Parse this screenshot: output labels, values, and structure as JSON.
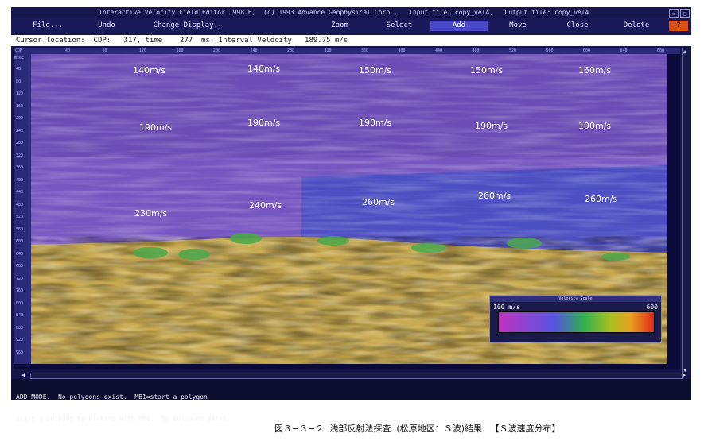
{
  "window": {
    "title": "Interactive Velocity Field Editor 1998.6,  (c) 1993 Advance Geophysical Corp.,   Input file: copy_vel4,   Output file: copy_vel4"
  },
  "menu": [
    {
      "label": "File...",
      "active": false
    },
    {
      "label": "Undo",
      "active": false
    },
    {
      "label": "Change Display..",
      "active": false
    },
    {
      "label": "Zoom",
      "active": false
    },
    {
      "label": "Select",
      "active": false
    },
    {
      "label": "Add",
      "active": true
    },
    {
      "label": "Move",
      "active": false
    },
    {
      "label": "Close",
      "active": false
    },
    {
      "label": "Delete",
      "active": false
    },
    {
      "label": "?",
      "active": false
    }
  ],
  "cursor": {
    "text": "Cursor location:  CDP:   317, time    277  ms, Interval Velocity   189.75 m/s"
  },
  "axes": {
    "cdp_label": "CDP",
    "cdp_ticks": [
      "40",
      "80",
      "120",
      "160",
      "200",
      "240",
      "280",
      "320",
      "360",
      "400",
      "440",
      "480",
      "520",
      "560",
      "600",
      "640",
      "680"
    ],
    "time_label": "msec",
    "time_ticks": [
      "40",
      "80",
      "120",
      "160",
      "200",
      "240",
      "280",
      "320",
      "360",
      "400",
      "440",
      "480",
      "520",
      "560",
      "600",
      "640",
      "680",
      "720",
      "760",
      "800",
      "840",
      "880",
      "920",
      "960"
    ]
  },
  "velocity_labels": [
    "140m/s",
    "140m/s",
    "150m/s",
    "150m/s",
    "160m/s",
    "190m/s",
    "190m/s",
    "190m/s",
    "190m/s",
    "190m/s",
    "230m/s",
    "240m/s",
    "260m/s",
    "260m/s",
    "260m/s"
  ],
  "scale": {
    "title": "Velocity Scale",
    "min_label": "100  m/s",
    "max_label": "600"
  },
  "status": {
    "line1": "ADD MODE.  No polygons exist.  MB1=start a polygon",
    "line2": "Start a polygon by picking with MB1.  No polygons exist."
  },
  "caption": "図３−３−２  浅部反射法探査  (松原地区：Ｓ波)結果   【Ｓ波速度分布】",
  "colors": {
    "layer_top": "#6d4fb8",
    "layer_mid": "#7a58c4",
    "layer_deep_right": "#4b4fc4",
    "sediment": "#c8aa50",
    "anomaly": "#48a848",
    "window_bg": "#15154a",
    "active_menu": "#4848c8",
    "help_button": "#e05010"
  }
}
